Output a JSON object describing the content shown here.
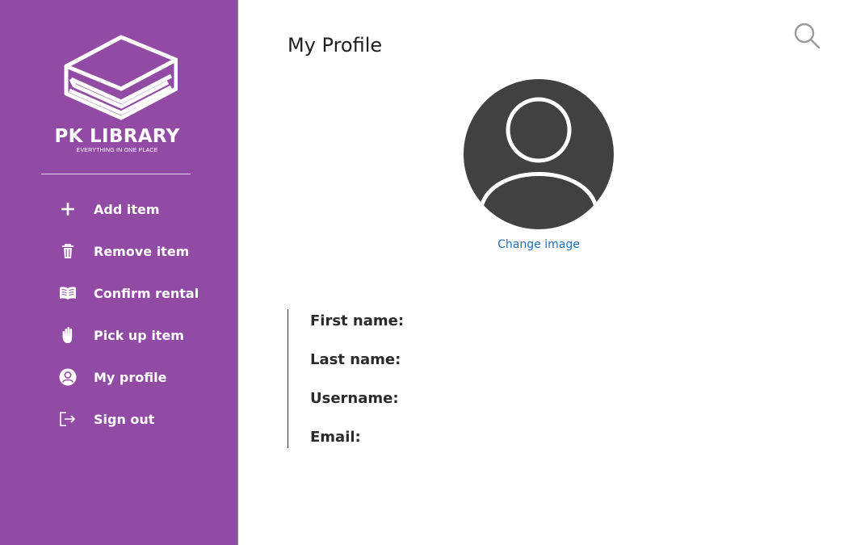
{
  "brand": {
    "name": "PK LIBRARY",
    "tagline": "EVERYTHING IN ONE PLACE"
  },
  "sidebar": {
    "items": [
      {
        "label": "Add item",
        "icon": "plus-icon"
      },
      {
        "label": "Remove item",
        "icon": "trash-icon"
      },
      {
        "label": "Confirm rental",
        "icon": "open-book-icon"
      },
      {
        "label": "Pick up item",
        "icon": "hand-icon"
      },
      {
        "label": "My profile",
        "icon": "user-circle-icon"
      },
      {
        "label": "Sign out",
        "icon": "sign-out-icon"
      }
    ]
  },
  "header": {
    "search_icon": "search-icon"
  },
  "main": {
    "title": "My Profile",
    "avatar_icon": "user-avatar-icon",
    "change_image_label": "Change image",
    "fields": [
      {
        "label": "First name:"
      },
      {
        "label": "Last name:"
      },
      {
        "label": "Username:"
      },
      {
        "label": "Email:"
      }
    ]
  },
  "colors": {
    "sidebar_bg": "#924ba5",
    "link": "#1f6fbf",
    "avatar": "#414042"
  }
}
